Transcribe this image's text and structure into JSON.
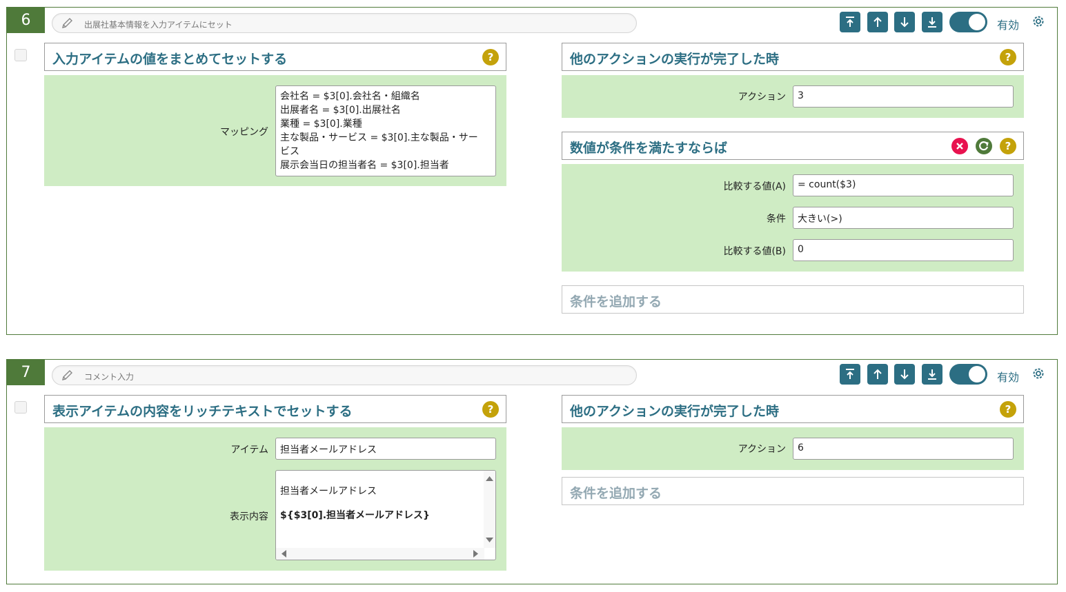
{
  "blocks": [
    {
      "number": "6",
      "comment": "出展社基本情報を入力アイテムにセット",
      "enabled_label": "有効",
      "action": {
        "title": "入力アイテムの値をまとめてセットする",
        "mapping_label": "マッピング",
        "mapping_lines": [
          "会社名 = $3[0].会社名・組織名",
          "出展者名 = $3[0].出展社名",
          "業種 = $3[0].業種",
          "主な製品・サービス = $3[0].主な製品・サー",
          "ビス",
          "展示会当日の担当者名 = $3[0].担当者"
        ]
      },
      "trigger": {
        "title": "他のアクションの実行が完了した時",
        "action_label": "アクション",
        "action_value": "3"
      },
      "condition": {
        "title": "数値が条件を満たすならば",
        "value_a_label": "比較する値(A)",
        "value_a": "= count($3)",
        "cond_label": "条件",
        "cond_value": "大きい(>)",
        "value_b_label": "比較する値(B)",
        "value_b": "0"
      },
      "add_condition": "条件を追加する"
    },
    {
      "number": "7",
      "comment": "コメント入力",
      "enabled_label": "有効",
      "action": {
        "title": "表示アイテムの内容をリッチテキストでセットする",
        "item_label": "アイテム",
        "item_value": "担当者メールアドレス",
        "content_label": "表示内容",
        "content_line1": "担当者メールアドレス",
        "content_line2": "${$3[0].担当者メールアドレス}"
      },
      "trigger": {
        "title": "他のアクションの実行が完了した時",
        "action_label": "アクション",
        "action_value": "6"
      },
      "add_condition": "条件を追加する"
    }
  ],
  "colors": {
    "accent": "#2c6e83",
    "brand_green": "#4f7a3a",
    "panel_bg": "#cfecc4",
    "help": "#c4a20a",
    "delete": "#e8124f",
    "refresh": "#4f7a3a"
  },
  "icons": [
    "pencil-icon",
    "move-top-icon",
    "move-up-icon",
    "move-down-icon",
    "move-bottom-icon",
    "toggle-switch",
    "gear-icon",
    "help-icon",
    "delete-icon",
    "refresh-icon"
  ]
}
